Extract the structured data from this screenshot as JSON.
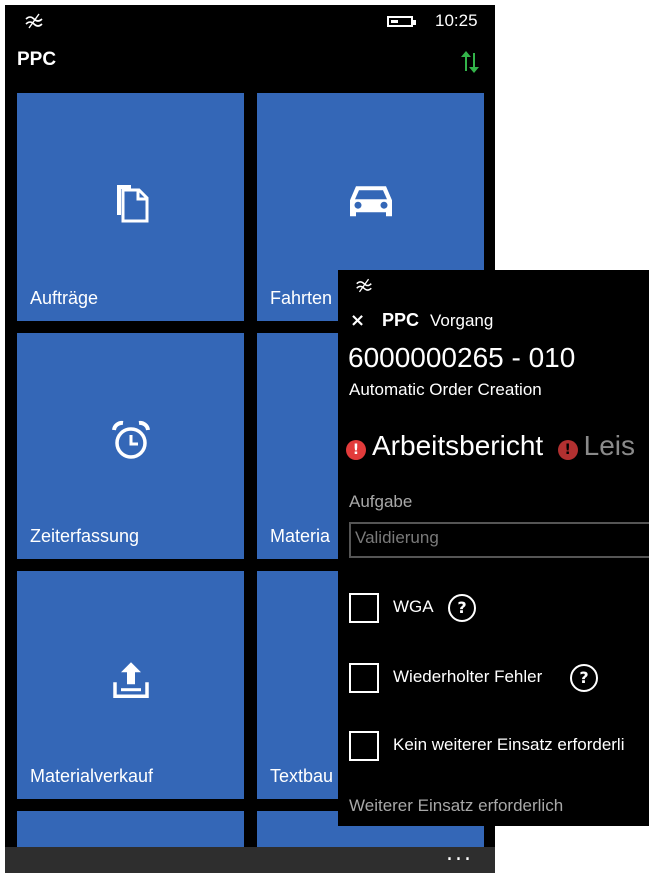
{
  "phone_main": {
    "status": {
      "time": "10:25"
    },
    "app_title": "PPC",
    "tiles": [
      {
        "label": "Aufträge",
        "icon": "documents-icon"
      },
      {
        "label": "Fahrten",
        "icon": "car-icon"
      },
      {
        "label": "Zeiterfassung",
        "icon": "alarm-clock-icon"
      },
      {
        "label": "Materia",
        "icon": ""
      },
      {
        "label": "Materialverkauf",
        "icon": "upload-icon"
      },
      {
        "label": "Textbau",
        "icon": ""
      }
    ],
    "appbar": {
      "more_label": "..."
    }
  },
  "phone_detail": {
    "close_label": "×",
    "app_title": "PPC",
    "page_title": "Vorgang",
    "order_number": "6000000265 - 010",
    "order_description": "Automatic Order Creation",
    "pivot": [
      {
        "label": "Arbeitsbericht",
        "warning": "!"
      },
      {
        "label": "Leis",
        "warning": "!"
      }
    ],
    "task_label": "Aufgabe",
    "task_value": "Validierung",
    "checkboxes": [
      {
        "label": "WGA",
        "help": "?"
      },
      {
        "label": "Wiederholter Fehler",
        "help": "?"
      },
      {
        "label": "Kein weiterer Einsatz erforderli"
      }
    ],
    "section_label": "Weiterer Einsatz erforderlich"
  },
  "colors": {
    "tile": "#3467b7",
    "sync": "#33b44a",
    "warning": "#e23b3b",
    "background": "#000000"
  }
}
